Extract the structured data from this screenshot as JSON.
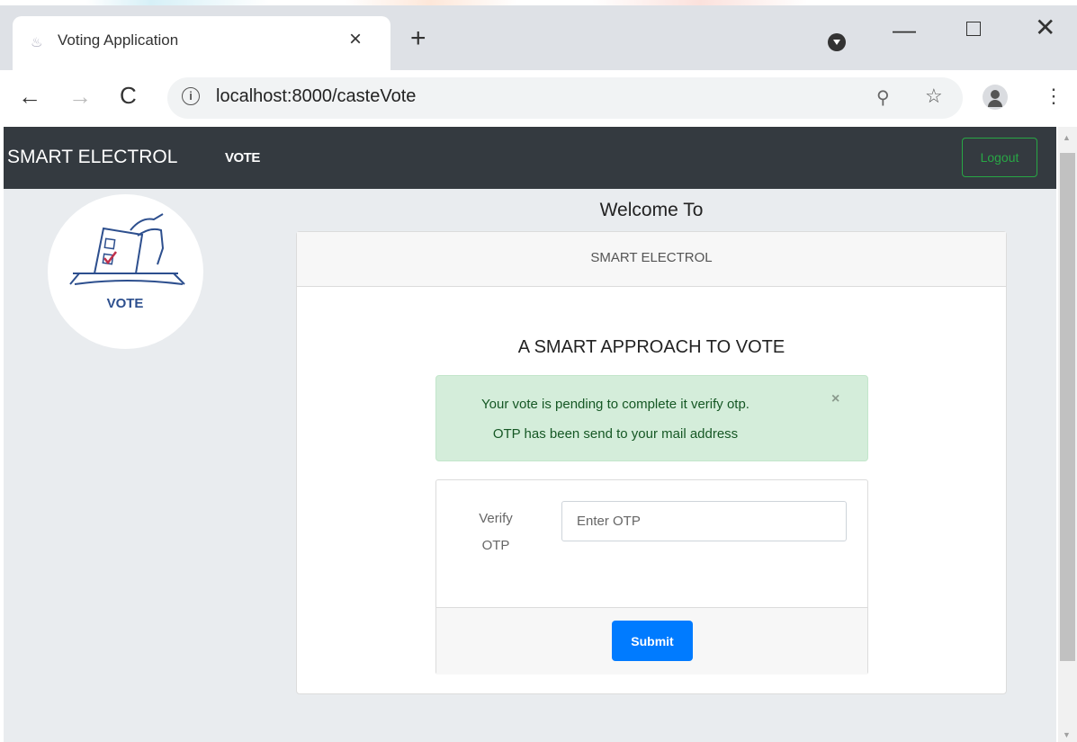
{
  "browser": {
    "tab_title": "Voting Application",
    "tab_close": "×",
    "new_tab": "+",
    "url": "localhost:8000/casteVote",
    "window_controls": {
      "minimize": "—",
      "close": "✕"
    },
    "nav": {
      "back": "←",
      "forward": "→",
      "reload": "C"
    },
    "icons": [
      "info-icon",
      "zoom-icon",
      "star-icon",
      "profile-icon",
      "menu-icon"
    ]
  },
  "navbar": {
    "brand": "SMART ELECTROL",
    "vote_link": "VOTE",
    "logout_label": "Logout",
    "logout_color": "#28a745",
    "background": "#343a40"
  },
  "sidebar": {
    "logo_text": "VOTE"
  },
  "main": {
    "welcome": "Welcome To",
    "card_header": "SMART ELECTROL",
    "tagline": "A SMART APPROACH TO VOTE",
    "alert": {
      "line1": "Your vote is pending to complete it verify otp.",
      "line2": "OTP has been send to your mail address",
      "close": "×",
      "background": "#d4edda"
    },
    "form": {
      "label_line1": "Verify",
      "label_line2": "OTP",
      "otp_placeholder": "Enter OTP",
      "otp_value": "",
      "submit_label": "Submit",
      "submit_color": "#007bff"
    }
  }
}
